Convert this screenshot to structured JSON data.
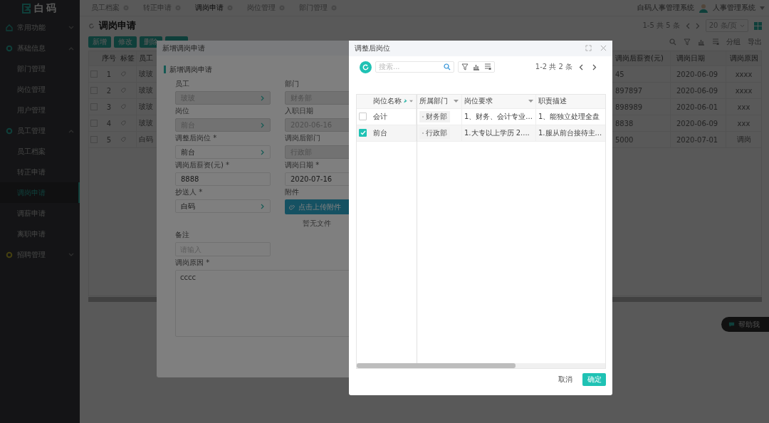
{
  "sidebar": {
    "logo": "白码",
    "groups": [
      {
        "label": "常用功能",
        "kind": "home",
        "expanded": false
      },
      {
        "label": "基础信息",
        "kind": "ring",
        "expanded": true,
        "children": [
          {
            "label": "部门管理",
            "selected": false
          },
          {
            "label": "岗位管理",
            "selected": false
          },
          {
            "label": "用户管理",
            "selected": false
          }
        ]
      },
      {
        "label": "员工管理",
        "kind": "ring",
        "expanded": true,
        "children": [
          {
            "label": "员工档案",
            "selected": false
          },
          {
            "label": "转正申请",
            "selected": false
          },
          {
            "label": "调岗申请",
            "selected": true
          },
          {
            "label": "调薪申请",
            "selected": false
          },
          {
            "label": "离职申请",
            "selected": false
          }
        ]
      },
      {
        "label": "招聘管理",
        "kind": "goldring",
        "expanded": false
      }
    ]
  },
  "tabs": [
    {
      "label": "员工档案",
      "selected": false
    },
    {
      "label": "转正申请",
      "selected": false
    },
    {
      "label": "调岗申请",
      "selected": true
    },
    {
      "label": "岗位管理",
      "selected": false
    },
    {
      "label": "部门管理",
      "selected": false
    }
  ],
  "header": {
    "system_name": "白码人事管理系统",
    "user": "人事管理系统"
  },
  "page": {
    "title": "调岗申请",
    "buttons": [
      "新增",
      "修改",
      "删除"
    ],
    "pagination": "1-5 共 5 条",
    "page_size": "20 条/页",
    "tools": [
      "分组",
      "导出"
    ],
    "table": {
      "columns_left": [
        "序号",
        "标签",
        "员工"
      ],
      "columns_right": [
        "调岗后薪资(元)",
        "调岗日期",
        "调岗原因"
      ],
      "rows": [
        {
          "index": "1",
          "employee": "玻玻",
          "salary": "45",
          "date": "2020-06-09",
          "reason": "xxxx",
          "checked": false
        },
        {
          "index": "2",
          "employee": "玻玻",
          "salary": "897897",
          "date": "2020-06-09",
          "reason": "xxxx",
          "checked": false
        },
        {
          "index": "3",
          "employee": "玻玻",
          "salary": "898989",
          "date": "2020-06-01",
          "reason": "xxx",
          "checked": false
        },
        {
          "index": "4",
          "employee": "玻玻",
          "salary": "8838",
          "date": "2020-06-09",
          "reason": "xxx",
          "checked": false
        },
        {
          "index": "5",
          "employee": "白码",
          "salary": "5000",
          "date": "2020-07-01",
          "reason": "调岗",
          "checked": false
        }
      ]
    }
  },
  "help_button": "帮助我",
  "form_dialog": {
    "title": "新增调岗申请",
    "section": "新增调岗申请",
    "fields": [
      {
        "label": "员工",
        "kind": "select",
        "value": "玻玻",
        "disabled": true
      },
      {
        "label": "部门",
        "kind": "text",
        "value": "财务部",
        "disabled": true
      },
      {
        "label": "岗位",
        "kind": "select",
        "value": "前台",
        "disabled": true
      },
      {
        "label": "入职日期",
        "kind": "text",
        "value": "2020-06-16",
        "disabled": true
      },
      {
        "label": "调整后岗位 *",
        "kind": "select",
        "value": "前台",
        "disabled": false
      },
      {
        "label": "调岗后部门",
        "kind": "text",
        "value": "行政部",
        "disabled": true
      },
      {
        "label": "调岗后薪资(元) *",
        "kind": "text",
        "value": "8888",
        "disabled": false
      },
      {
        "label": "调岗日期 *",
        "kind": "text",
        "value": "2020-07-16",
        "disabled": false
      },
      {
        "label": "抄送人 *",
        "kind": "select",
        "value": "白码",
        "disabled": false
      },
      {
        "label": "附件",
        "kind": "upload",
        "button": "点击上传附件",
        "note": "暂无文件"
      },
      {
        "label": "备注",
        "kind": "textarea",
        "placeholder": "请输入"
      },
      {
        "label": "调岗原因 *",
        "kind": "longtext",
        "value": "cccc"
      }
    ]
  },
  "picker_dialog": {
    "title": "调整后岗位",
    "search": {
      "placeholder": "搜索..."
    },
    "pagination": "1-2 共 2 条",
    "columns": [
      {
        "label": "岗位名称",
        "pinned": true,
        "menu": true
      },
      {
        "label": "所属部门",
        "pinned": false,
        "menu": true
      },
      {
        "label": "岗位要求",
        "pinned": false,
        "menu": true
      },
      {
        "label": "职责描述",
        "pinned": false,
        "menu": false
      }
    ],
    "rows": [
      {
        "name": "会计",
        "department": "财务部",
        "requirement": "1、财务、会计专业...",
        "description": "1、能独立处理全盘",
        "selected": false
      },
      {
        "name": "前台",
        "department": "行政部",
        "requirement": "1.大专以上学历 2....",
        "description": "1.服从前台接待主...",
        "selected": true
      }
    ],
    "buttons": [
      "取消",
      "确定"
    ]
  }
}
